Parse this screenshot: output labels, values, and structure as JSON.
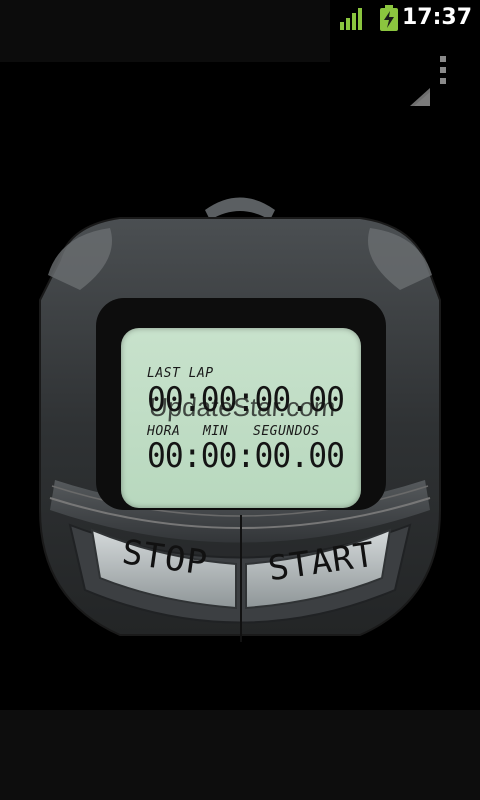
{
  "status_bar": {
    "time": "17:37",
    "signal_icon": "signal-bars-icon",
    "battery_icon": "battery-charging-icon"
  },
  "menu": {
    "overflow_icon": "overflow-menu-icon",
    "resize_icon": "resize-corner-icon"
  },
  "display": {
    "last_lap_label": "LAST LAP",
    "last_lap_time": "00:00:00.00",
    "watermark": "UpdateStar.com",
    "col_hours": "HORA",
    "col_min": "MIN",
    "col_seconds": "SEGUNDOS",
    "main_time": "00:00:00.00"
  },
  "buttons": {
    "stop_label": "STOP",
    "start_label": "START"
  },
  "colors": {
    "lcd": "#bcd9c1",
    "body": "#3a3d3f",
    "button_face": "#a9b0b1",
    "status_icon_green": "#8bc53f"
  }
}
